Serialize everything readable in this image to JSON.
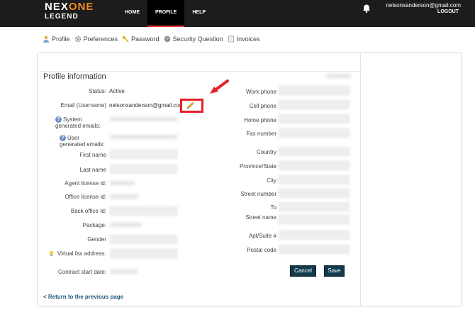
{
  "header": {
    "logo_line1_a": "NEX",
    "logo_line1_b": "ONE",
    "logo_line2": "LEGEND",
    "nav": [
      "HOME",
      "PROFILE",
      "HELP"
    ],
    "user_email": "nelsonxanderson@gmail.com",
    "logout": "LOGOUT"
  },
  "subnav": [
    "Profile",
    "Preferences",
    "Password",
    "Security Question",
    "Invoices"
  ],
  "profile": {
    "title": "Profile information",
    "status_label": "Status:",
    "status_value": "Active",
    "email_label": "Email (Username)",
    "email_value": "nelsonxanderson@gmail.com",
    "system_emails_label": "System generated emails:",
    "user_emails_label": "User generated emails:",
    "first_name_label": "First name",
    "last_name_label": "Last name",
    "agent_license_label": "Agent license id:",
    "office_license_label": "Office license id:",
    "back_office_label": "Back office Id:",
    "package_label": "Package:",
    "gender_label": "Gender",
    "virtual_fax_label": "Virtual fax address:",
    "contract_start_label": "Contract start date:"
  },
  "contact": {
    "work_phone_label": "Work phone",
    "cell_phone_label": "Cell phone",
    "home_phone_label": "Home phone",
    "fax_label": "Fax number",
    "country_label": "Country",
    "province_label": "Province/State",
    "city_label": "City",
    "street_number_label": "Street number",
    "to_label": "To",
    "street_name_label": "Street name",
    "apt_label": "Apt/Suite #",
    "postal_label": "Postal code"
  },
  "buttons": {
    "cancel": "Cancel",
    "save": "Save"
  },
  "return_link": "< Return to the previous page",
  "colors": {
    "accent": "#f28a1e",
    "highlight": "#e8202a",
    "button": "#123a4c"
  }
}
